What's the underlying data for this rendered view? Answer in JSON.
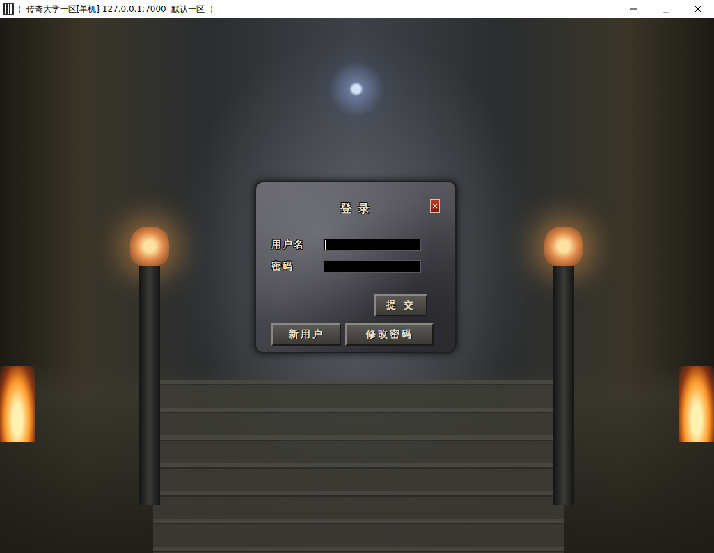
{
  "window": {
    "title": "¦  传奇大学一区[单机] 127.0.0.1:7000  默认一区  ¦",
    "controls": [
      {
        "kind": "minimize",
        "disabled": false
      },
      {
        "kind": "maximize",
        "disabled": true
      },
      {
        "kind": "close",
        "disabled": false
      }
    ]
  },
  "dialog": {
    "title": "登 录",
    "fields": [
      {
        "label": "用户名",
        "value": "",
        "focused": true,
        "secret": false
      },
      {
        "label": "密码",
        "value": "",
        "focused": false,
        "secret": true
      }
    ],
    "submit": "提 交",
    "buttons": [
      "新用户",
      "修改密码"
    ]
  }
}
